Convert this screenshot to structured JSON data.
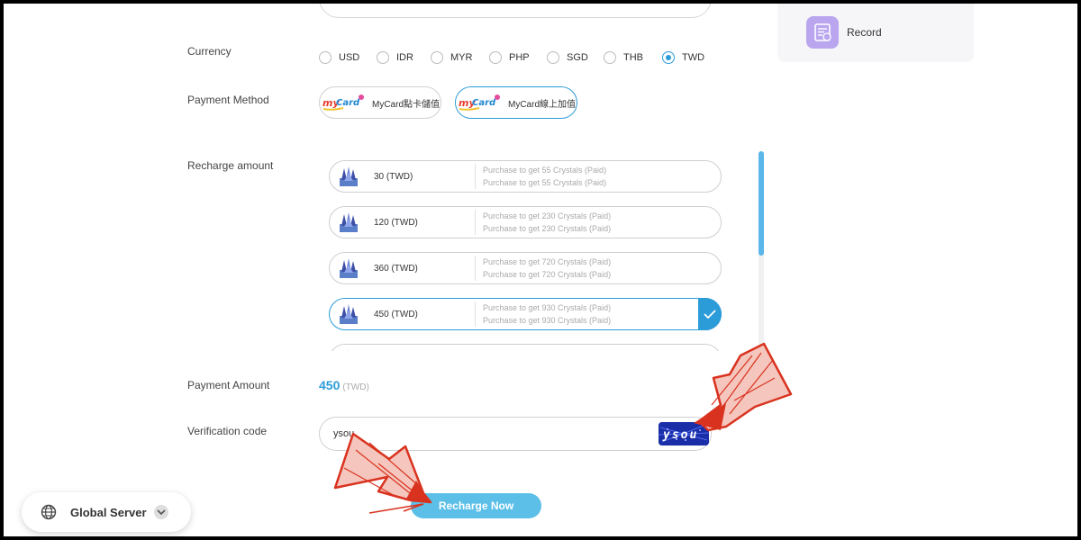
{
  "record": {
    "label": "Record",
    "icon": "receipt-icon"
  },
  "form": {
    "currency_label": "Currency",
    "payment_method_label": "Payment Method",
    "recharge_amount_label": "Recharge amount",
    "payment_amount_label": "Payment Amount",
    "verification_label": "Verification code"
  },
  "currencies": [
    {
      "label": "USD",
      "selected": false
    },
    {
      "label": "IDR",
      "selected": false
    },
    {
      "label": "MYR",
      "selected": false
    },
    {
      "label": "PHP",
      "selected": false
    },
    {
      "label": "SGD",
      "selected": false
    },
    {
      "label": "THB",
      "selected": false
    },
    {
      "label": "TWD",
      "selected": true
    }
  ],
  "payment_methods": [
    {
      "name": "MyCard點卡儲值",
      "logo": "MyCard",
      "selected": false
    },
    {
      "name": "MyCard線上加值",
      "logo": "MyCard",
      "selected": true
    }
  ],
  "recharge_options": [
    {
      "amount": "30 (TWD)",
      "line1": "Purchase to get 55 Crystals (Paid)",
      "line2": "Purchase to get 55 Crystals (Paid)",
      "selected": false
    },
    {
      "amount": "120 (TWD)",
      "line1": "Purchase to get 230 Crystals (Paid)",
      "line2": "Purchase to get 230 Crystals (Paid)",
      "selected": false
    },
    {
      "amount": "360 (TWD)",
      "line1": "Purchase to get 720 Crystals (Paid)",
      "line2": "Purchase to get 720 Crystals (Paid)",
      "selected": false
    },
    {
      "amount": "450 (TWD)",
      "line1": "Purchase to get 930 Crystals (Paid)",
      "line2": "Purchase to get 930 Crystals (Paid)",
      "selected": true
    }
  ],
  "payment_amount": {
    "value": "450",
    "currency": "(TWD)"
  },
  "verification": {
    "value": "ysou",
    "captcha_text": "ysou"
  },
  "recharge_button": "Recharge Now",
  "server": {
    "label": "Global Server"
  },
  "colors": {
    "accent": "#2b9cd8",
    "button": "#5bbfe8",
    "record_icon_bg": "#b9a6ef",
    "captcha_bg": "#1a2ea8"
  }
}
